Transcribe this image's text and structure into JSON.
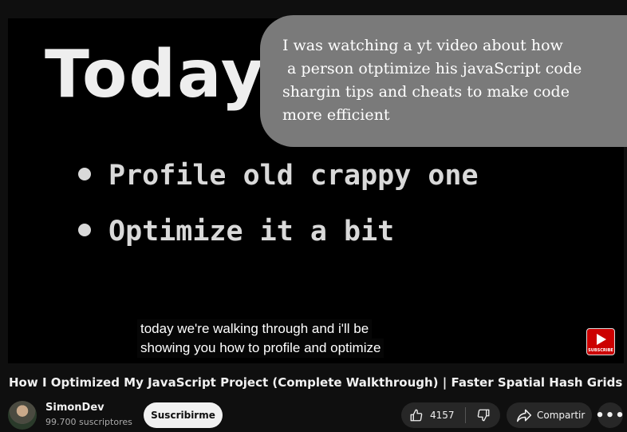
{
  "video": {
    "slide_heading": "Today",
    "bullets": [
      "Profile old crappy one",
      "Optimize it a bit"
    ],
    "overlay_comment": "I was watching a yt video about how\n a person otptimize his javaScript code\nshargin tips and cheats to make code\nmore efficient",
    "captions": [
      "today we're walking through and i'll be",
      "showing you how to profile and optimize"
    ],
    "watermark": {
      "text": "SUBSCRIBE",
      "color": "#cc0000"
    }
  },
  "title": "How I Optimized My JavaScript Project (Complete Walkthrough) | Faster Spatial Hash Grids",
  "channel": {
    "name": "SimonDev",
    "subscribers": "99.700 suscriptores",
    "subscribe_label": "Suscribirme"
  },
  "actions": {
    "like_count": "4157",
    "like_icon": "thumbs-up-icon",
    "dislike_icon": "thumbs-down-icon",
    "share_label": "Compartir",
    "share_icon": "share-arrow-icon",
    "more_icon": "more-horizontal-icon",
    "more_glyph": "•••"
  },
  "colors": {
    "background": "#0f0f0f",
    "pill": "#272727",
    "bubble": "#7a7a7a"
  }
}
